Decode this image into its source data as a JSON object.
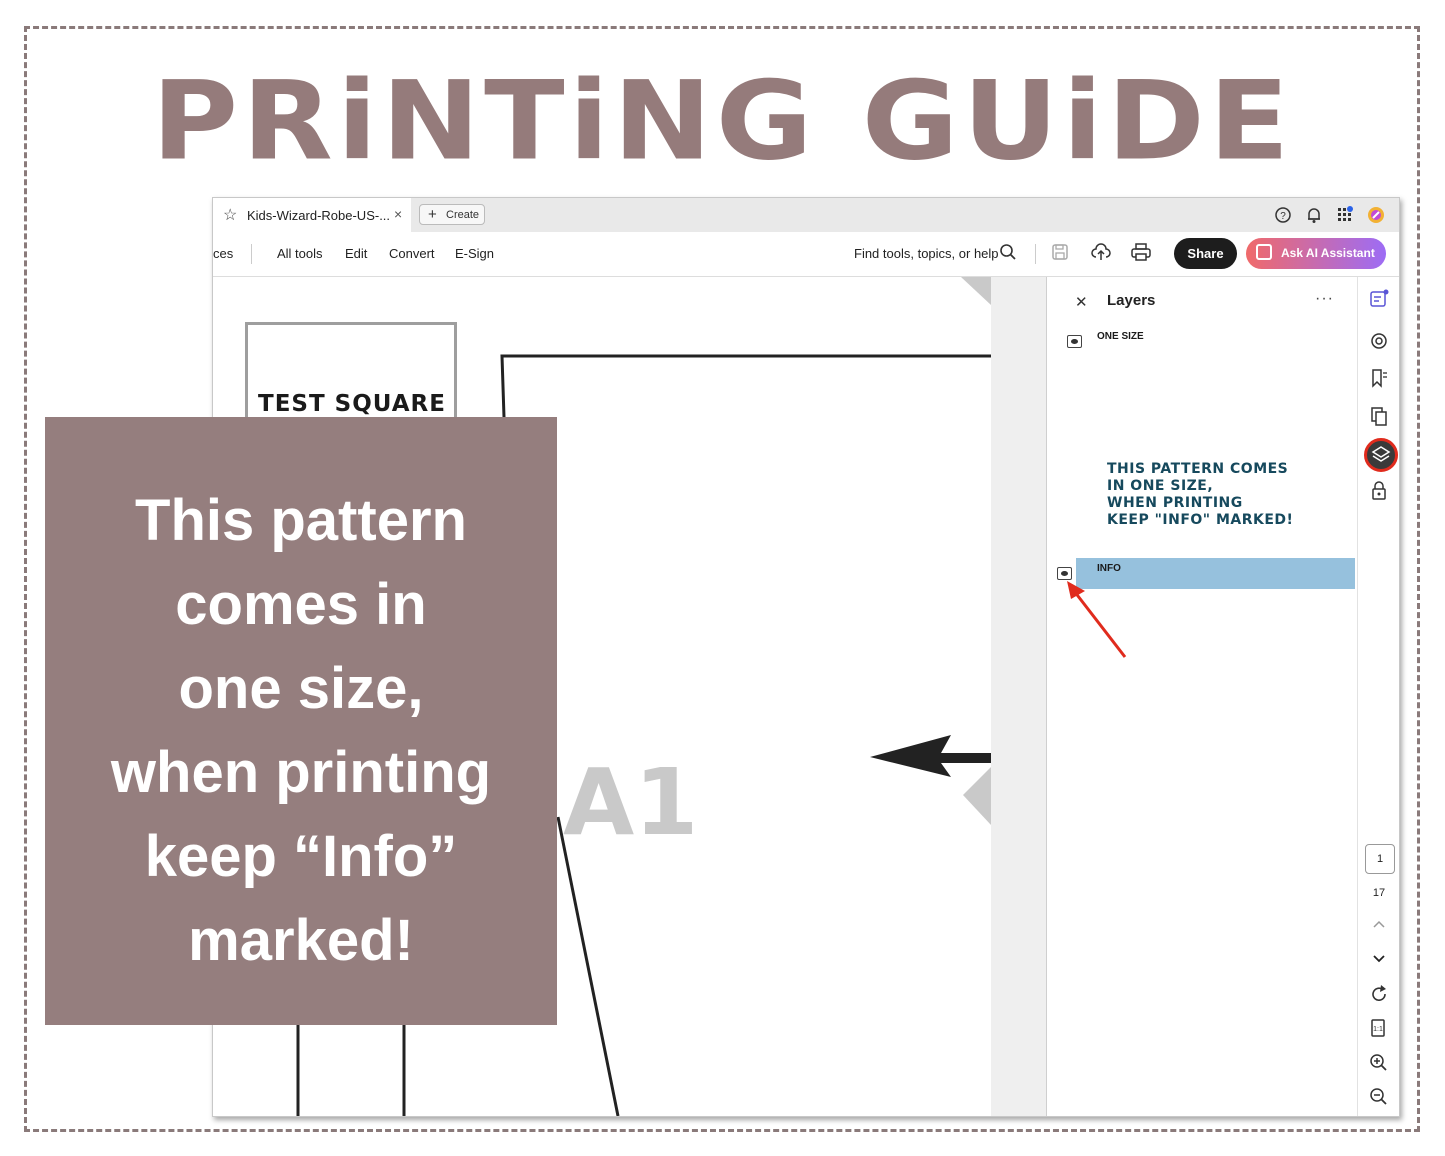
{
  "headline": "PRiNTiNG GUiDE",
  "window": {
    "tab_title": "Kids-Wizard-Robe-US-...",
    "tab_close": "×",
    "create_label": "Create",
    "toolbar": {
      "truncated_item": "ces",
      "all_tools": "All tools",
      "edit": "Edit",
      "convert": "Convert",
      "esign": "E-Sign",
      "search_placeholder": "Find tools, topics, or help",
      "share": "Share",
      "ask_ai": "Ask AI Assistant"
    }
  },
  "document": {
    "test_square": "TEST SQUARE",
    "page_label": "A1"
  },
  "layers_panel": {
    "title": "Layers",
    "more": "···",
    "layers": [
      {
        "name": "ONE SIZE",
        "selected": false
      },
      {
        "name": "INFO",
        "selected": true
      }
    ],
    "annotation": [
      "This pattern comes",
      "in one size,",
      "when printing",
      "keep \"Info\" marked!"
    ]
  },
  "rail": {
    "current_page": "1",
    "total_pages": "17"
  },
  "overlay_text": [
    "This pattern",
    "comes in",
    "one size,",
    "when printing",
    "keep “Info”",
    "marked!"
  ],
  "colors": {
    "brand": "#957b7b",
    "layer_selected": "#96c1dd",
    "annotation": "#16495d",
    "highlight": "#e02b1d"
  },
  "icons": [
    "star-icon",
    "close-icon",
    "plus-icon",
    "help-icon",
    "bell-icon",
    "apps-icon",
    "avatar-icon",
    "search-icon",
    "save-icon",
    "upload-cloud-icon",
    "print-icon",
    "ai-icon",
    "eye-icon",
    "layers-icon",
    "lock-icon",
    "bookmark-icon",
    "pages-icon",
    "comment-icon",
    "edit-icon",
    "rotate-icon",
    "fit-page-icon",
    "zoom-in-icon",
    "zoom-out-icon",
    "chevron-up-icon",
    "chevron-down-icon"
  ]
}
